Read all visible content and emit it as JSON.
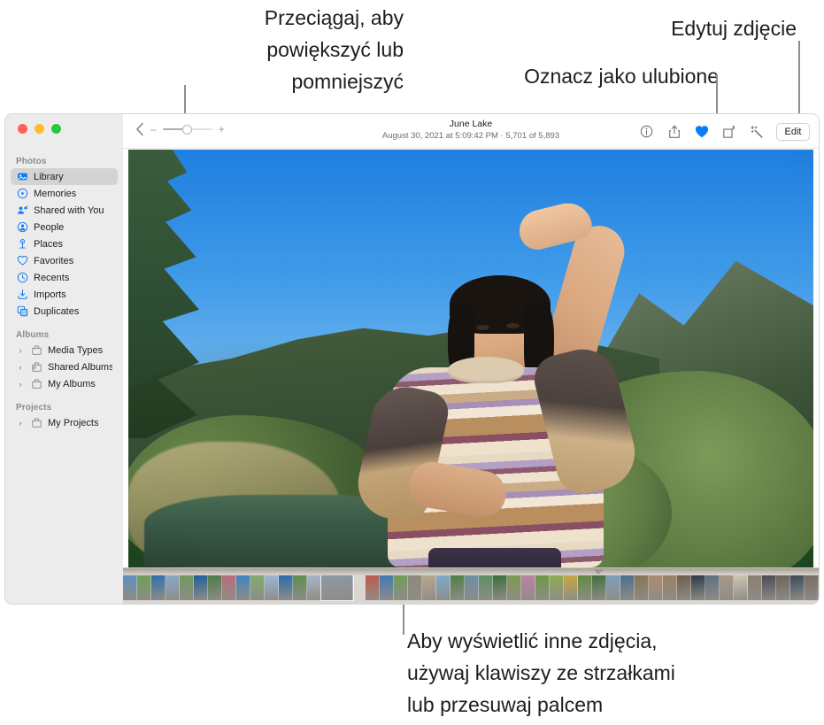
{
  "callouts": {
    "zoom": "Przeciągaj, aby\npowiększyć lub\npomniejszyć",
    "favorite": "Oznacz jako ulubione",
    "edit": "Edytuj zdjęcie",
    "browse": "Aby wyświetlić inne zdjęcia,\nużywaj klawiszy ze strzałkami\nlub przesuwaj palcem"
  },
  "window": {
    "traffic_lights": [
      {
        "name": "close",
        "color": "#ff5f57"
      },
      {
        "name": "minimize",
        "color": "#febc2e"
      },
      {
        "name": "zoom",
        "color": "#28c840"
      }
    ]
  },
  "sidebar": {
    "sections": [
      {
        "title": "Photos",
        "items": [
          {
            "label": "Library",
            "icon": "library-icon",
            "selected": true,
            "disclosure": false
          },
          {
            "label": "Memories",
            "icon": "memories-icon",
            "selected": false,
            "disclosure": false
          },
          {
            "label": "Shared with You",
            "icon": "shared-icon",
            "selected": false,
            "disclosure": false
          },
          {
            "label": "People",
            "icon": "people-icon",
            "selected": false,
            "disclosure": false
          },
          {
            "label": "Places",
            "icon": "places-icon",
            "selected": false,
            "disclosure": false
          },
          {
            "label": "Favorites",
            "icon": "heart-icon",
            "selected": false,
            "disclosure": false
          },
          {
            "label": "Recents",
            "icon": "clock-icon",
            "selected": false,
            "disclosure": false
          },
          {
            "label": "Imports",
            "icon": "import-icon",
            "selected": false,
            "disclosure": false
          },
          {
            "label": "Duplicates",
            "icon": "duplicate-icon",
            "selected": false,
            "disclosure": false
          }
        ]
      },
      {
        "title": "Albums",
        "items": [
          {
            "label": "Media Types",
            "icon": "album-icon",
            "selected": false,
            "disclosure": true
          },
          {
            "label": "Shared Albums",
            "icon": "shared-album-icon",
            "selected": false,
            "disclosure": true
          },
          {
            "label": "My Albums",
            "icon": "album-icon",
            "selected": false,
            "disclosure": true
          }
        ]
      },
      {
        "title": "Projects",
        "items": [
          {
            "label": "My Projects",
            "icon": "album-icon",
            "selected": false,
            "disclosure": true
          }
        ]
      }
    ]
  },
  "toolbar": {
    "back_icon": "chevron-left-icon",
    "zoom_out_label": "–",
    "zoom_in_label": "+",
    "zoom_value": 40,
    "title": "June Lake",
    "meta": "August 30, 2021 at 5:09:42 PM  ·  5,701 of 5,893",
    "buttons": [
      {
        "name": "info-button",
        "icon": "info-icon",
        "active": false
      },
      {
        "name": "share-button",
        "icon": "share-icon",
        "active": false
      },
      {
        "name": "favorite-button",
        "icon": "heart-filled-icon",
        "active": true
      },
      {
        "name": "rotate-button",
        "icon": "rotate-icon",
        "active": false
      },
      {
        "name": "enhance-button",
        "icon": "magic-wand-icon",
        "active": false
      }
    ],
    "edit_label": "Edit",
    "accent_color": "#0a7cf5"
  },
  "photo": {
    "alt": "Person in striped knit sweater shielding eyes, mountain lake landscape",
    "selected_index": 14
  },
  "filmstrip": {
    "thumbs": [
      "#5e8fbf",
      "#6f9f55",
      "#2f6fae",
      "#8aa9c8",
      "#6d9a59",
      "#1f5f9c",
      "#4a7d46",
      "#bc6b7a",
      "#3f84c0",
      "#7fae68",
      "#9bb9d6",
      "#2d6ba8",
      "#5d8f4f",
      "#a8b6c9",
      "#8c9aa6",
      "#c05a4a",
      "#3d7ab4",
      "#6f9c57",
      "#8e8a7c",
      "#b9a98f",
      "#7fa9cf",
      "#4f7f44",
      "#6a8fa8",
      "#5a8f62",
      "#3c6f3a",
      "#7e9a4e",
      "#c17fa8",
      "#6b9b43",
      "#8fae52",
      "#caa93f",
      "#5f8a3e",
      "#44703b",
      "#7ca0b8",
      "#4a6f8d",
      "#86764f",
      "#b08a6e",
      "#9a7f5e",
      "#6d5f4a",
      "#2a3a4a",
      "#5f6f7e",
      "#a89a86",
      "#cfc6b4",
      "#8a7f6e",
      "#4a4a52",
      "#6e6258",
      "#3a4a5a",
      "#7a6a5e"
    ]
  }
}
